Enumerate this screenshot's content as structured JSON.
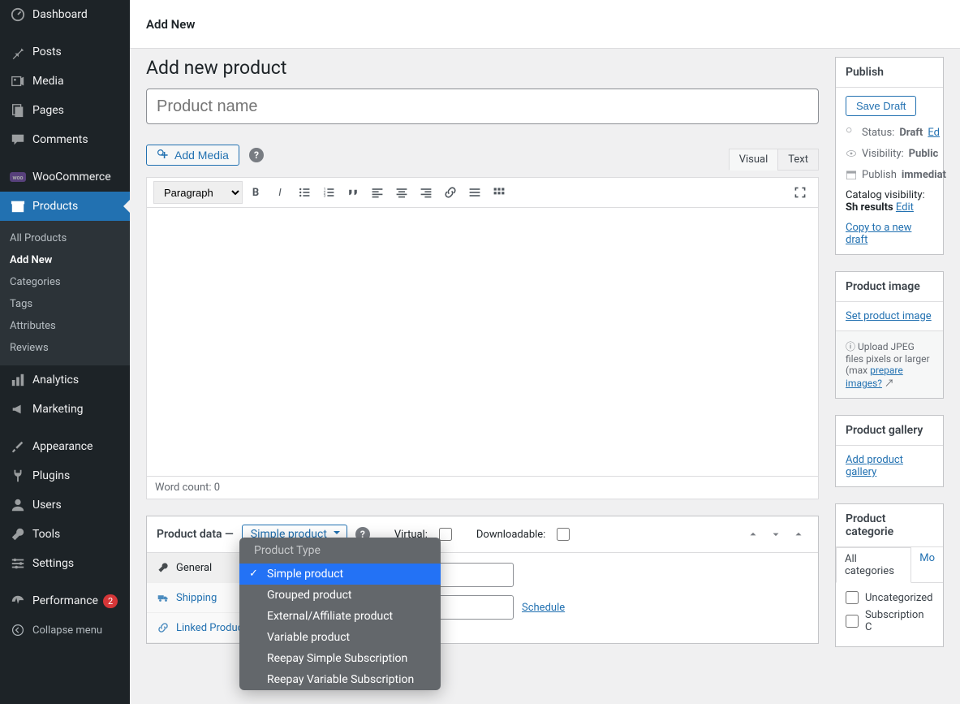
{
  "sidebar": {
    "items": [
      {
        "label": "Dashboard",
        "icon": "dashboard"
      },
      {
        "label": "Posts",
        "icon": "pin"
      },
      {
        "label": "Media",
        "icon": "media"
      },
      {
        "label": "Pages",
        "icon": "page"
      },
      {
        "label": "Comments",
        "icon": "comment"
      },
      {
        "label": "WooCommerce",
        "icon": "woo"
      },
      {
        "label": "Products",
        "icon": "archive",
        "active": true
      },
      {
        "label": "Analytics",
        "icon": "chart"
      },
      {
        "label": "Marketing",
        "icon": "megaphone"
      },
      {
        "label": "Appearance",
        "icon": "brush"
      },
      {
        "label": "Plugins",
        "icon": "plug"
      },
      {
        "label": "Users",
        "icon": "user"
      },
      {
        "label": "Tools",
        "icon": "wrench"
      },
      {
        "label": "Settings",
        "icon": "settings"
      },
      {
        "label": "Performance",
        "icon": "gauge",
        "badge": "2"
      }
    ],
    "submenu": [
      "All Products",
      "Add New",
      "Categories",
      "Tags",
      "Attributes",
      "Reviews"
    ],
    "submenu_current": "Add New",
    "collapse": "Collapse menu"
  },
  "topbar": {
    "title": "Add New"
  },
  "page_title": "Add new product",
  "title_placeholder": "Product name",
  "media_button": "Add Media",
  "editor_tabs": {
    "visual": "Visual",
    "text": "Text"
  },
  "toolbar_select": "Paragraph",
  "word_count_label": "Word count: 0",
  "product_data": {
    "heading": "Product data —",
    "selected": "Simple product",
    "virtual_label": "Virtual:",
    "downloadable_label": "Downloadable:",
    "tabs": [
      "General",
      "Shipping",
      "Linked Produc"
    ],
    "schedule": "Schedule"
  },
  "dropdown": {
    "header": "Product Type",
    "options": [
      "Simple product",
      "Grouped product",
      "External/Affiliate product",
      "Variable product",
      "Reepay Simple Subscription",
      "Reepay Variable Subscription"
    ],
    "selected_index": 0
  },
  "publish_box": {
    "title": "Publish",
    "save_draft": "Save Draft",
    "status_label": "Status:",
    "status_value": "Draft",
    "status_edit": "Ed",
    "visibility_label": "Visibility:",
    "visibility_value": "Public",
    "publish_label": "Publish",
    "publish_value": "immediat",
    "catalog_label": "Catalog visibility:",
    "catalog_value": "Sh",
    "catalog_results": "results",
    "edit": "Edit",
    "copy": "Copy to a new draft"
  },
  "image_box": {
    "title": "Product image",
    "set": "Set product image",
    "hint_pre": "Upload JPEG files",
    "hint_mid": "pixels or larger (max",
    "hint_link": "prepare images?"
  },
  "gallery_box": {
    "title": "Product gallery",
    "add": "Add product gallery"
  },
  "categories_box": {
    "title": "Product categorie",
    "tab_all": "All categories",
    "tab_most": "Mo",
    "cats": [
      "Uncategorized",
      "Subscription C"
    ]
  }
}
